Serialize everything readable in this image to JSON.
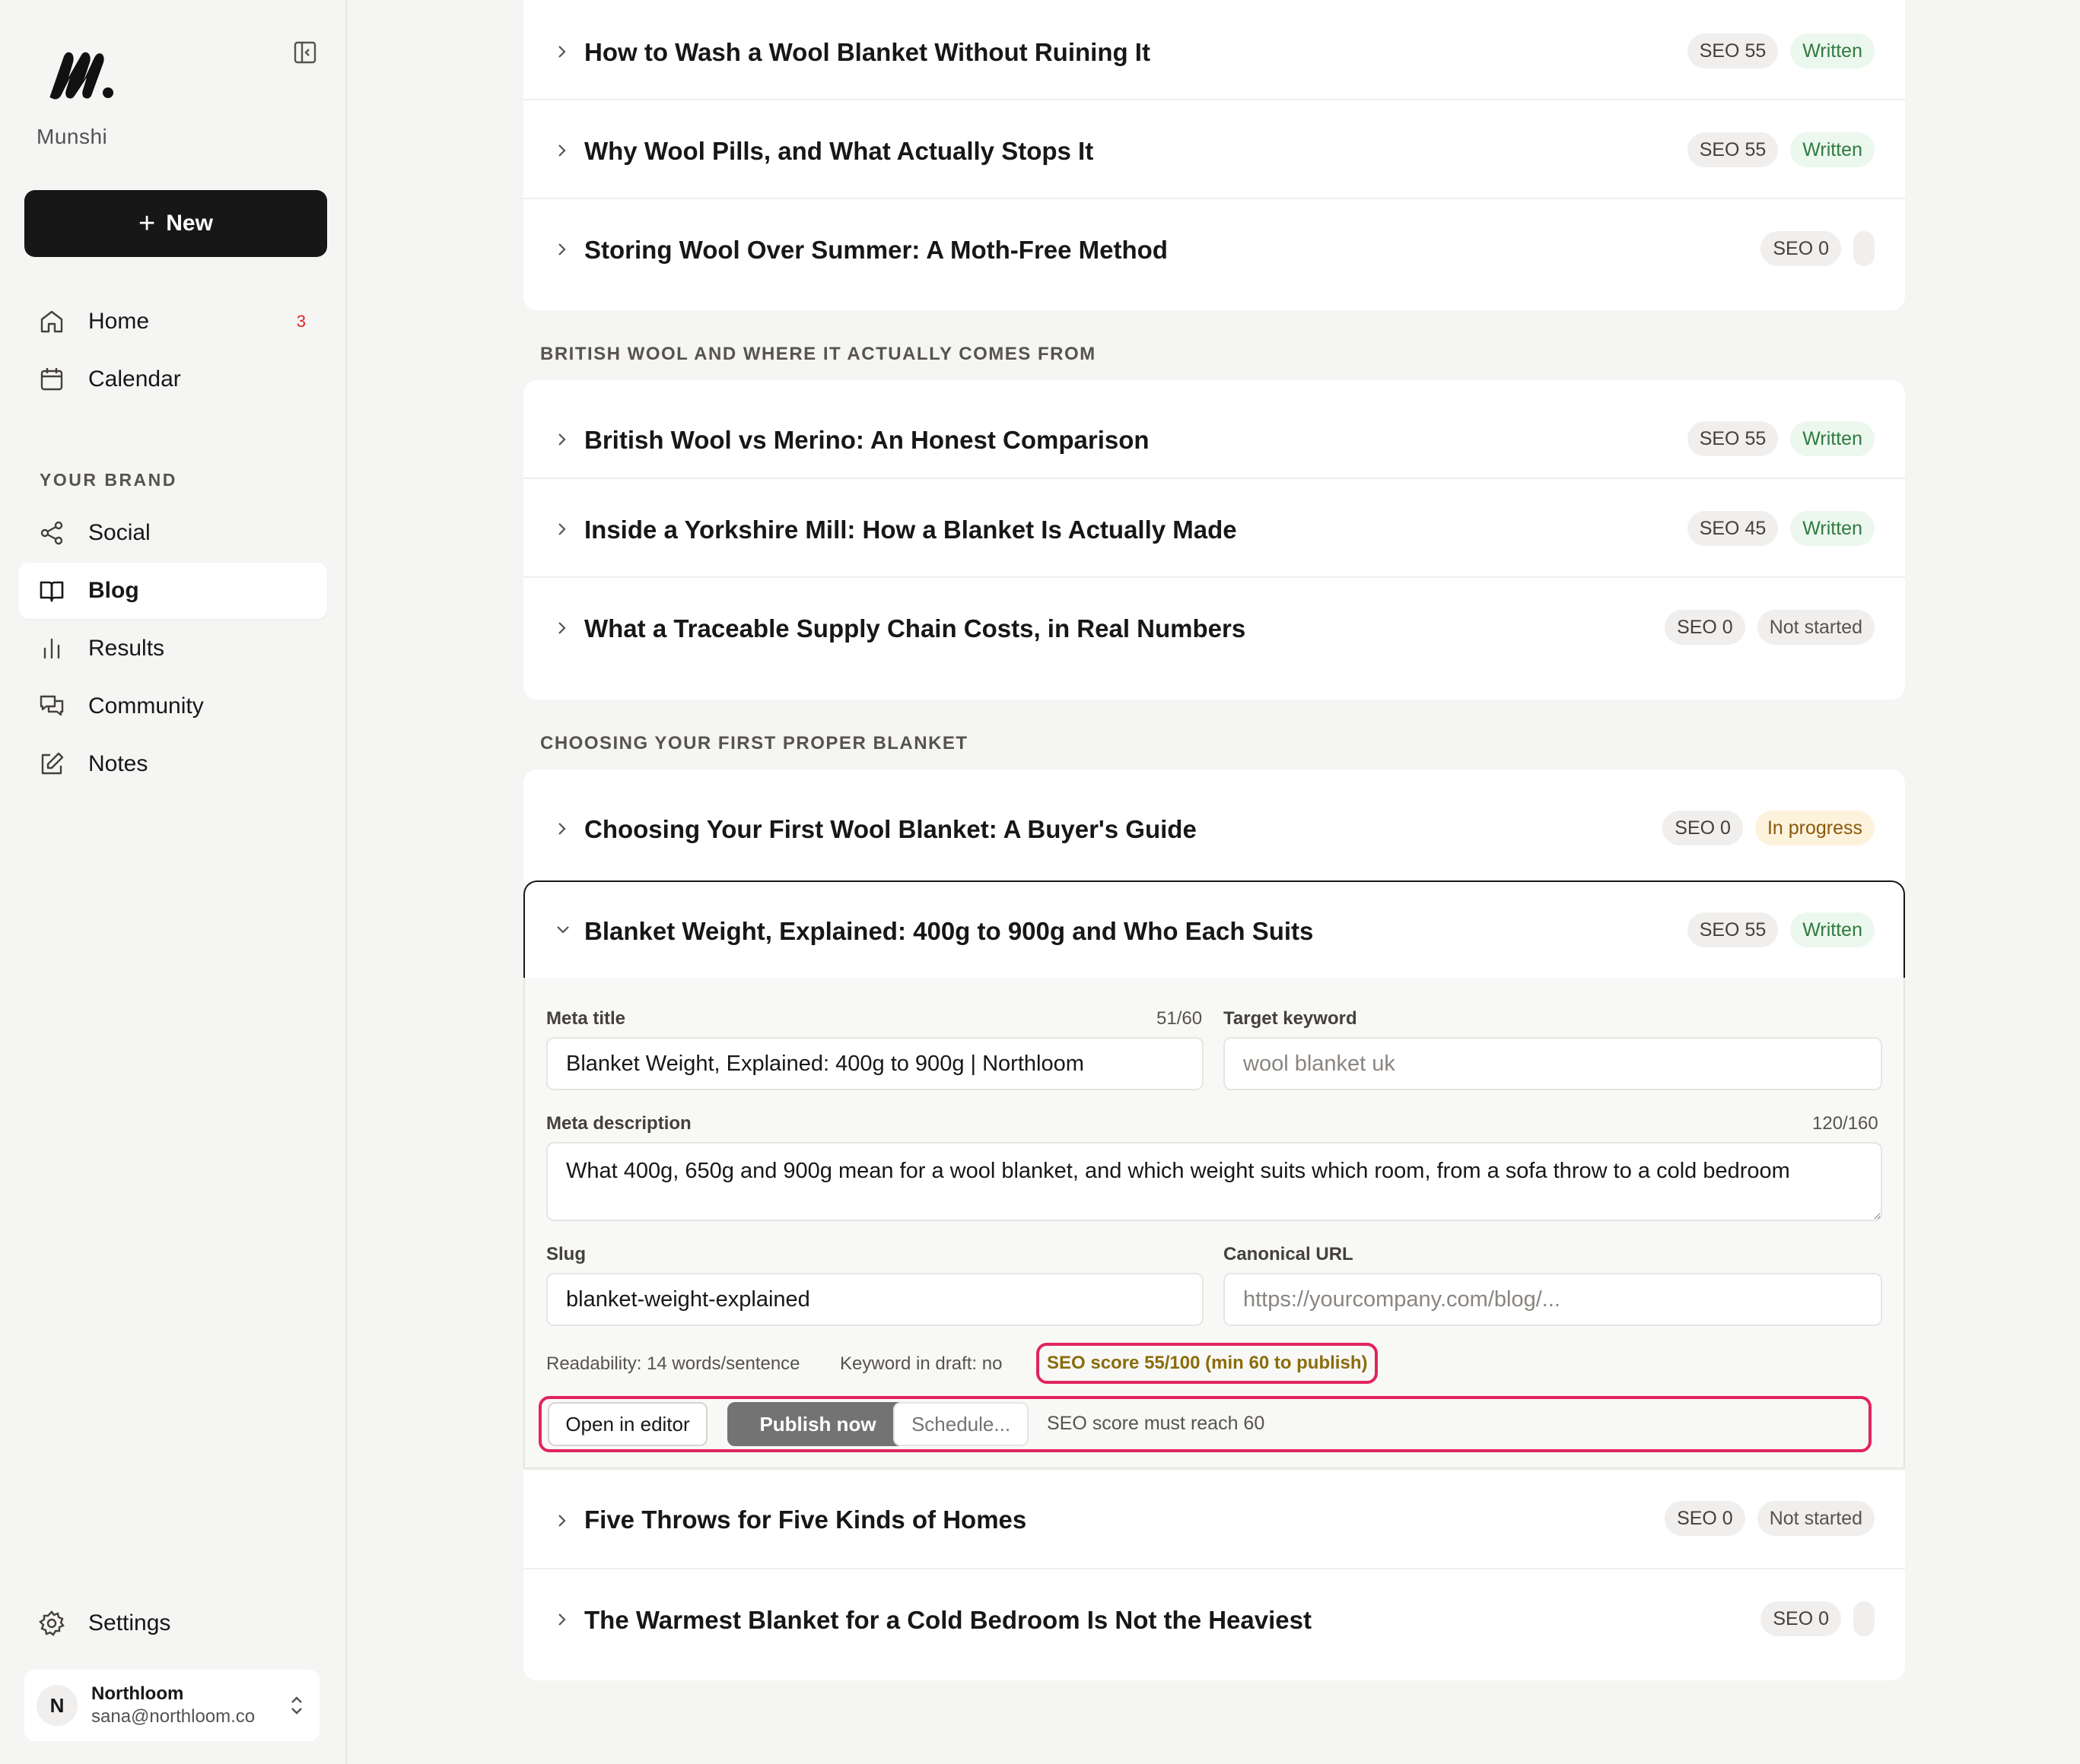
{
  "sidebar": {
    "brand": "Munshi",
    "new_label": "New",
    "nav": [
      {
        "label": "Home",
        "badge": "3"
      },
      {
        "label": "Calendar"
      }
    ],
    "section_label": "YOUR BRAND",
    "brand_nav": [
      {
        "label": "Social"
      },
      {
        "label": "Blog"
      },
      {
        "label": "Results"
      },
      {
        "label": "Community"
      },
      {
        "label": "Notes"
      }
    ],
    "settings_label": "Settings",
    "account": {
      "initial": "N",
      "name": "Northloom",
      "email": "sana@northloom.co"
    }
  },
  "groups": [
    {
      "rows": [
        {
          "title": "How to Wash a Wool Blanket Without Ruining It",
          "seo": "SEO 55",
          "status": "Written"
        },
        {
          "title": "Why Wool Pills, and What Actually Stops It",
          "seo": "SEO 55",
          "status": "Written"
        },
        {
          "title": "Storing Wool Over Summer: A Moth-Free Method",
          "seo": "SEO 0",
          "status": ""
        }
      ]
    },
    {
      "label": "BRITISH WOOL AND WHERE IT ACTUALLY COMES FROM",
      "rows": [
        {
          "title": "British Wool vs Merino: An Honest Comparison",
          "seo": "SEO 55",
          "status": "Written"
        },
        {
          "title": "Inside a Yorkshire Mill: How a Blanket Is Actually Made",
          "seo": "SEO 45",
          "status": "Written"
        },
        {
          "title": "What a Traceable Supply Chain Costs, in Real Numbers",
          "seo": "SEO 0",
          "status": "Not started"
        }
      ]
    },
    {
      "label": "CHOOSING YOUR FIRST PROPER BLANKET",
      "rows": [
        {
          "title": "Choosing Your First Wool Blanket: A Buyer's Guide",
          "seo": "SEO 0",
          "status": "In progress"
        }
      ],
      "expanded": {
        "title": "Blanket Weight, Explained: 400g to 900g and Who Each Suits",
        "seo": "SEO 55",
        "status": "Written",
        "meta_title_label": "Meta title",
        "meta_title_count": "51/60",
        "meta_title_value": "Blanket Weight, Explained: 400g to 900g | Northloom",
        "target_keyword_label": "Target keyword",
        "target_keyword_placeholder": "wool blanket uk",
        "meta_description_label": "Meta description",
        "meta_description_count": "120/160",
        "meta_description_value": "What 400g, 650g and 900g mean for a wool blanket, and which weight suits which room, from a sofa throw to a cold bedroom",
        "slug_label": "Slug",
        "slug_value": "blanket-weight-explained",
        "canonical_label": "Canonical URL",
        "canonical_placeholder": "https://yourcompany.com/blog/...",
        "readability": "Readability: 14 words/sentence",
        "keyword_in_draft": "Keyword in draft: no",
        "seo_warning": "SEO score 55/100 (min 60 to publish)",
        "open_editor": "Open in editor",
        "publish_now": "Publish now",
        "schedule": "Schedule...",
        "hint": "SEO score must reach 60"
      },
      "after_rows": [
        {
          "title": "Five Throws for Five Kinds of Homes",
          "seo": "SEO 0",
          "status": "Not started"
        },
        {
          "title": "The Warmest Blanket for a Cold Bedroom Is Not the Heaviest",
          "seo": "SEO 0",
          "status": ""
        }
      ]
    }
  ],
  "colors": {
    "highlight": "#e0245e",
    "written": "#2f7a3f",
    "in_progress": "#8a5a0b"
  }
}
